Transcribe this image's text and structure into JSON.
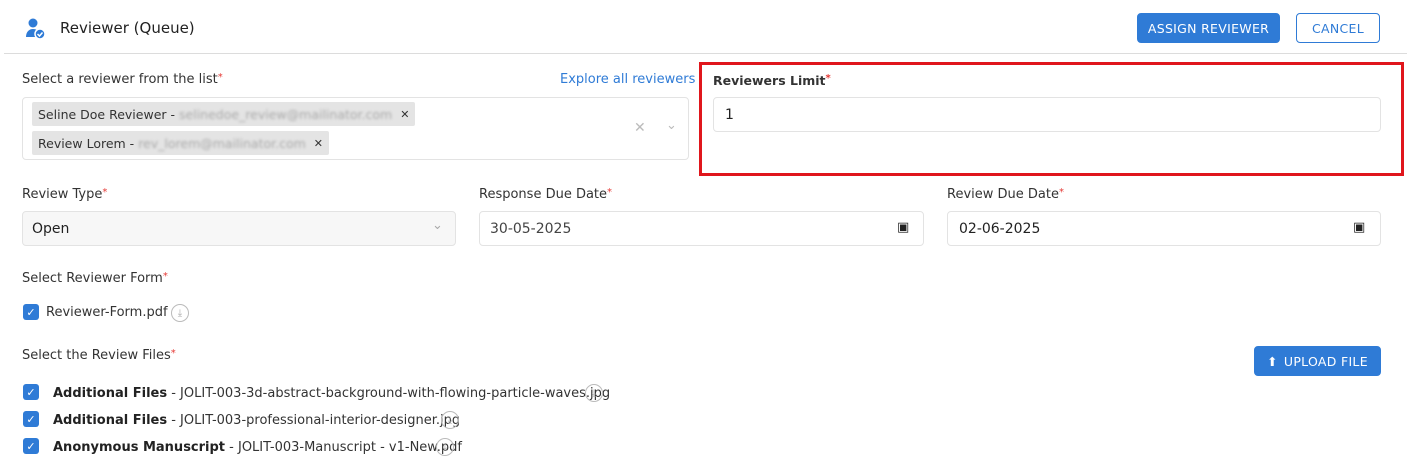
{
  "header": {
    "title": "Reviewer (Queue)",
    "assign_label": "ASSIGN REVIEWER",
    "cancel_label": "CANCEL"
  },
  "reviewer_select": {
    "label": "Select a reviewer from the list",
    "explore_link": "Explore all reviewers",
    "chips": [
      {
        "name": "Seline Doe Reviewer - ",
        "email": "selinedoe_review@mailinator.com"
      },
      {
        "name": "Review Lorem - ",
        "email": "rev_lorem@mailinator.com"
      }
    ]
  },
  "reviewers_limit": {
    "label": "Reviewers Limit",
    "value": "1"
  },
  "review_type": {
    "label": "Review Type",
    "value": "Open"
  },
  "response_due": {
    "label": "Response Due Date",
    "value": "30-05-2025"
  },
  "review_due": {
    "label": "Review Due Date",
    "value": "02-06-2025"
  },
  "reviewer_form": {
    "label": "Select Reviewer Form",
    "file": "Reviewer-Form.pdf",
    "checked": true
  },
  "review_files": {
    "label": "Select the Review Files",
    "upload_label": "UPLOAD FILE",
    "items": [
      {
        "type": "Additional Files",
        "name": " - JOLIT-003-3d-abstract-background-with-flowing-particle-waves.jpg",
        "checked": true
      },
      {
        "type": "Additional Files",
        "name": " - JOLIT-003-professional-interior-designer.jpg",
        "checked": true
      },
      {
        "type": "Anonymous Manuscript",
        "name": " - JOLIT-003-Manuscript - v1-New.pdf",
        "checked": true
      }
    ]
  },
  "colors": {
    "accent": "#2f7bd6",
    "highlight": "#e0161c"
  }
}
